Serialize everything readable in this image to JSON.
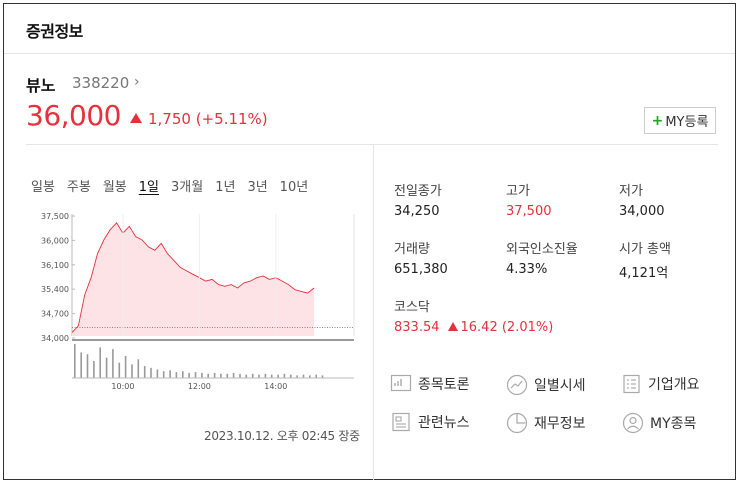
{
  "header": {
    "title": "증권정보"
  },
  "stock": {
    "name": "뷰노",
    "code": "338220",
    "code_arrow": "›",
    "price": "36,000",
    "change": "1,750",
    "change_pct": "(+5.11%)",
    "my_button": "MY등록"
  },
  "tabs": [
    {
      "label": "일봉"
    },
    {
      "label": "주봉"
    },
    {
      "label": "월봉"
    },
    {
      "label": "1일"
    },
    {
      "label": "3개월"
    },
    {
      "label": "1년"
    },
    {
      "label": "3년"
    },
    {
      "label": "10년"
    }
  ],
  "chart_data": {
    "type": "area",
    "y_ticks": [
      "37,500",
      "36,000",
      "36,100",
      "35,400",
      "34,700",
      "34,000"
    ],
    "x_ticks": [
      "10:00",
      "12:00",
      "14:00"
    ],
    "reference_line": 34250,
    "series": [
      {
        "values": [
          34100,
          34300,
          35200,
          35700,
          36400,
          36800,
          37100,
          37300,
          37000,
          37200,
          36900,
          36800,
          36600,
          36500,
          36700,
          36400,
          36200,
          36000,
          35900,
          35800,
          35700,
          35600,
          35650,
          35500,
          35450,
          35500,
          35400,
          35550,
          35600,
          35700,
          35750,
          35650,
          35700,
          35600,
          35500,
          35350,
          35300,
          35250,
          35400
        ]
      }
    ],
    "volume": [
      40,
      30,
      28,
      20,
      36,
      24,
      34,
      18,
      26,
      16,
      22,
      14,
      12,
      10,
      8,
      9,
      7,
      8,
      6,
      7,
      6,
      5,
      6,
      5,
      5,
      6,
      5,
      4,
      5,
      4,
      5,
      4,
      4,
      5,
      4,
      3,
      4,
      3,
      4,
      3
    ]
  },
  "timestamp": "2023.10.12. 오후 02:45 장중",
  "stats": {
    "prev_close": {
      "label": "전일종가",
      "value": "34,250"
    },
    "high": {
      "label": "고가",
      "value": "37,500"
    },
    "low": {
      "label": "저가",
      "value": "34,000"
    },
    "volume": {
      "label": "거래량",
      "value": "651,380"
    },
    "foreign": {
      "label": "외국인소진율",
      "value": "4.33%"
    },
    "market_cap": {
      "label": "시가 총액",
      "value": "4,121억"
    },
    "index": {
      "label": "코스닥",
      "value": "833.54",
      "change": "16.42 (2.01%)"
    }
  },
  "links": {
    "discussion": "종목토론",
    "daily": "일별시세",
    "company": "기업개요",
    "news": "관련뉴스",
    "finance": "재무정보",
    "my_stock": "MY종목"
  },
  "colors": {
    "up": "#e8303d",
    "accent_green": "#19a81e"
  }
}
